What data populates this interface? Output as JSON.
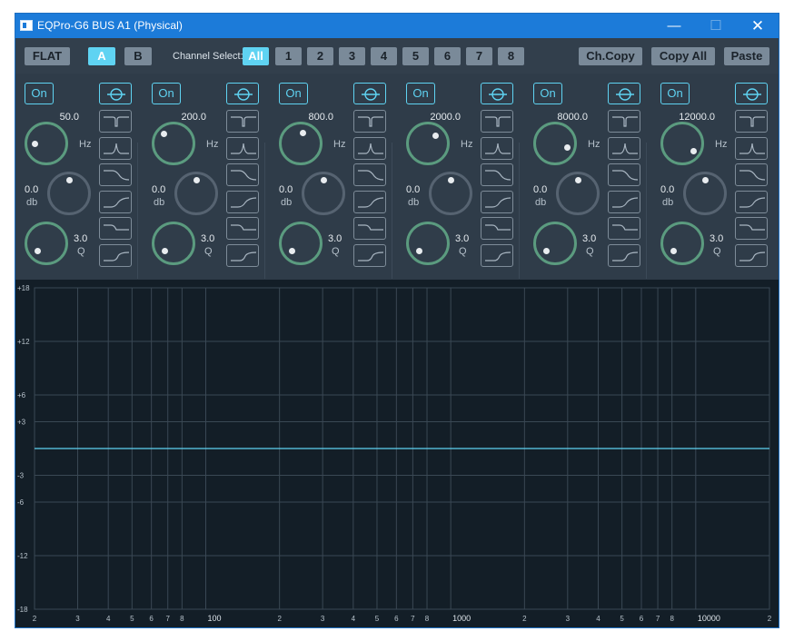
{
  "window": {
    "title": "EQPro-G6 BUS A1 (Physical)",
    "minimize": "—",
    "maximize": "☐",
    "close": "✕"
  },
  "toolbar": {
    "flat": "FLAT",
    "preset_a": "A",
    "preset_b": "B",
    "channel_select_label": "Channel Select:",
    "channels": [
      "All",
      "1",
      "2",
      "3",
      "4",
      "5",
      "6",
      "7",
      "8"
    ],
    "selected_channel": "All",
    "selected_preset": "A",
    "ch_copy": "Ch.Copy",
    "copy_all": "Copy All",
    "paste": "Paste"
  },
  "bands": [
    {
      "on": "On",
      "freq": "50.0",
      "gain": "0.0",
      "q": "3.0"
    },
    {
      "on": "On",
      "freq": "200.0",
      "gain": "0.0",
      "q": "3.0"
    },
    {
      "on": "On",
      "freq": "800.0",
      "gain": "0.0",
      "q": "3.0"
    },
    {
      "on": "On",
      "freq": "2000.0",
      "gain": "0.0",
      "q": "3.0"
    },
    {
      "on": "On",
      "freq": "8000.0",
      "gain": "0.0",
      "q": "3.0"
    },
    {
      "on": "On",
      "freq": "12000.0",
      "gain": "0.0",
      "q": "3.0"
    }
  ],
  "units": {
    "freq": "Hz",
    "gain": "db",
    "q": "Q"
  },
  "filter_types": [
    "notch-icon",
    "peak-icon",
    "low-shelf-icon",
    "high-shelf-icon",
    "low-pass-icon",
    "high-pass-icon"
  ],
  "graph": {
    "y_ticks": [
      "+18",
      "+12",
      "+6",
      "+3",
      "-3",
      "-6",
      "-12",
      "-18"
    ],
    "y_values": [
      18,
      12,
      6,
      3,
      -3,
      -6,
      -12,
      -18
    ],
    "x_labels": [
      "2",
      "3",
      "4",
      "5",
      "6",
      "7",
      "8",
      "100",
      "2",
      "3",
      "4",
      "5",
      "6",
      "7",
      "8",
      "1000",
      "2",
      "3",
      "4",
      "5",
      "6",
      "7",
      "8",
      "10000",
      "2"
    ],
    "x_freqs": [
      20,
      30,
      40,
      50,
      60,
      70,
      80,
      100,
      200,
      300,
      400,
      500,
      600,
      700,
      800,
      1000,
      2000,
      3000,
      4000,
      5000,
      6000,
      7000,
      8000,
      10000,
      20000
    ],
    "x_range_hz": [
      20,
      20000
    ],
    "y_range_db": [
      -18,
      18
    ],
    "response_db": 0,
    "colors": {
      "grid": "#3a4854",
      "response": "#5fd3f2",
      "accent": "#5fd3f2",
      "knob": "#5b9b7f"
    }
  }
}
